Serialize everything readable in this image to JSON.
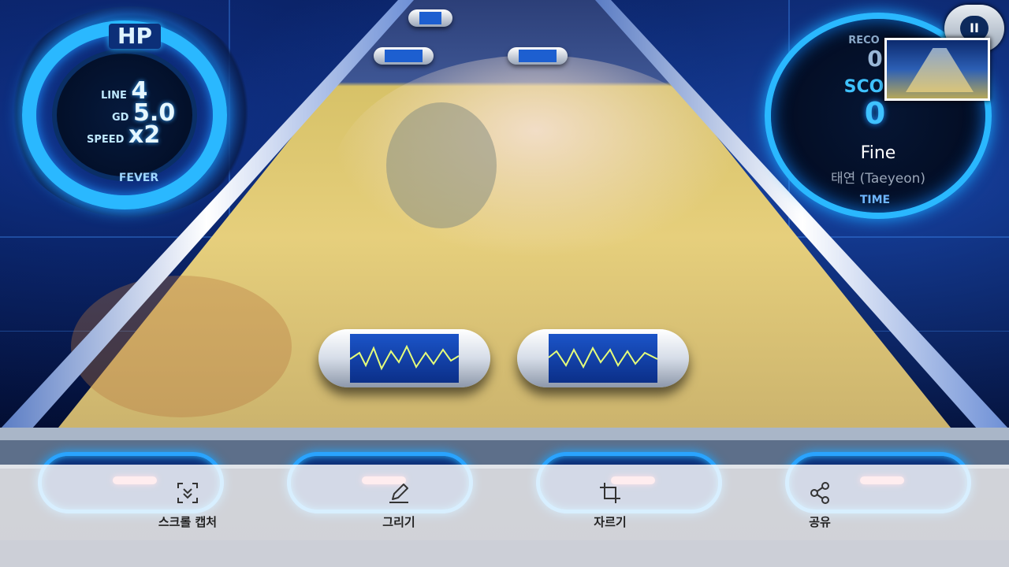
{
  "hud": {
    "hp_label": "HP",
    "line_key": "LINE",
    "line_value": "4",
    "gd_key": "GD",
    "gd_value": "5.0",
    "speed_key": "SPEED",
    "speed_value": "x2",
    "fever_label": "FEVER"
  },
  "score_panel": {
    "record_label": "RECO",
    "record_value": "0",
    "score_label": "SCO",
    "score_value": "0",
    "song_title": "Fine",
    "song_artist": "태연 (Taeyeon)",
    "time_label": "TIME"
  },
  "pause_button": {
    "icon": "pause-icon",
    "glyph": "II"
  },
  "toolbar": {
    "items": [
      {
        "label": "스크롤 캡처",
        "icon": "scroll-capture-icon"
      },
      {
        "label": "그리기",
        "icon": "pen-icon"
      },
      {
        "label": "자르기",
        "icon": "crop-icon"
      },
      {
        "label": "공유",
        "icon": "share-icon"
      }
    ]
  },
  "colors": {
    "accent": "#2ab8ff",
    "score": "#3fc2ff",
    "background": "#03103a"
  }
}
